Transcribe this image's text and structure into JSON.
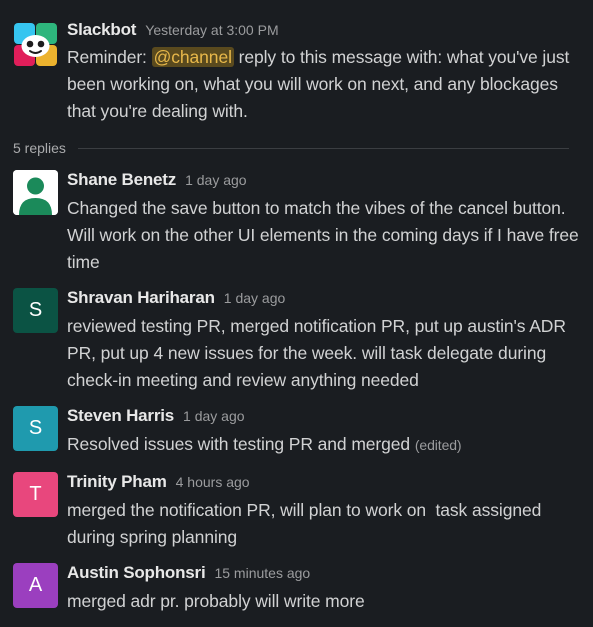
{
  "thread": {
    "parent": {
      "name": "Slackbot",
      "time": "Yesterday at 3:00 PM",
      "text_before": "Reminder: ",
      "mention": "@channel",
      "text_after": " reply to this message with: what you've just been working on, what you will work on next, and any blockages that you're dealing with."
    },
    "replies_label": "5 replies",
    "replies": [
      {
        "name": "Shane Benetz",
        "time": "1 day ago",
        "text": "Changed the save button to match the vibes of the cancel button. Will work on the other UI elements in the coming days if I have free time",
        "avatar_color": "#ffffff"
      },
      {
        "name": "Shravan Hariharan",
        "time": "1 day ago",
        "text": "reviewed testing PR, merged notification PR, put up austin's ADR PR, put up 4 new issues for the week. will task delegate during check-in meeting and review anything needed",
        "avatar_letter": "S",
        "avatar_color": "#0b5344"
      },
      {
        "name": "Steven Harris",
        "time": "1 day ago",
        "text": "Resolved issues with testing PR and merged",
        "edited": "(edited)",
        "avatar_letter": "S",
        "avatar_color": "#1f9aae"
      },
      {
        "name": "Trinity Pham",
        "time": "4 hours ago",
        "text": "merged the notification PR, will plan to work on  task assigned during spring planning",
        "avatar_letter": "T",
        "avatar_color": "#e8477d"
      },
      {
        "name": "Austin Sophonsri",
        "time": "15 minutes ago",
        "text": "merged adr pr. probably will write more",
        "avatar_letter": "A",
        "avatar_color": "#9b3fbf"
      }
    ]
  }
}
